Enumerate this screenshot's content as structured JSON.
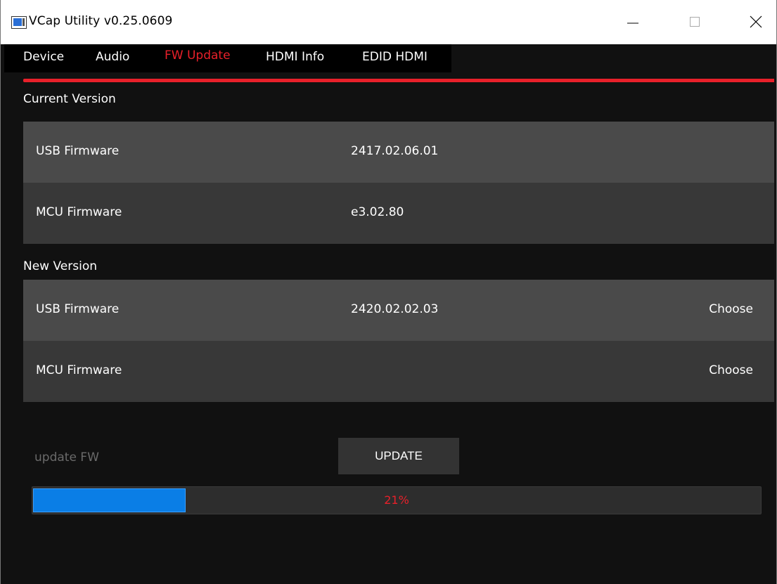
{
  "window": {
    "title": "VCap Utility  v0.25.0609"
  },
  "tabs": [
    {
      "label": "Device"
    },
    {
      "label": "Audio"
    },
    {
      "label": "FW Update"
    },
    {
      "label": "HDMI Info"
    },
    {
      "label": "EDID HDMI"
    }
  ],
  "active_tab": "FW Update",
  "current_version": {
    "heading": "Current Version",
    "rows": [
      {
        "label": "USB Firmware",
        "value": "2417.02.06.01"
      },
      {
        "label": "MCU Firmware",
        "value": "e3.02.80"
      }
    ]
  },
  "new_version": {
    "heading": "New Version",
    "rows": [
      {
        "label": "USB Firmware",
        "value": "2420.02.02.03",
        "action": "Choose"
      },
      {
        "label": "MCU Firmware",
        "value": "",
        "action": "Choose"
      }
    ]
  },
  "update": {
    "label": "update FW",
    "button": "UPDATE"
  },
  "progress": {
    "percent": 21,
    "text": "21%"
  },
  "colors": {
    "accent": "#e8202a",
    "progress_fill": "#0a7ee6",
    "background": "#111111"
  }
}
